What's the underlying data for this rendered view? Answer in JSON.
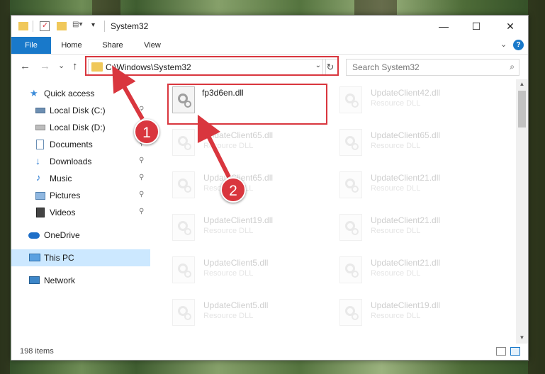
{
  "window": {
    "title": "System32",
    "controls": {
      "minimize": "—",
      "maximize": "☐",
      "close": "✕"
    }
  },
  "ribbon": {
    "tabs": [
      "File",
      "Home",
      "Share",
      "View"
    ],
    "expand_glyph": "⌄",
    "help_glyph": "?"
  },
  "nav": {
    "back_glyph": "←",
    "forward_glyph": "→",
    "recent_glyph": "⌄",
    "up_glyph": "↑",
    "address": "C:\\Windows\\System32",
    "search_placeholder": "Search System32"
  },
  "sidebar": {
    "items": [
      {
        "label": "Quick access",
        "icon": "star-icon"
      },
      {
        "label": "Local Disk (C:)",
        "icon": "drive-icon"
      },
      {
        "label": "Local Disk (D:)",
        "icon": "drive-icon"
      },
      {
        "label": "Documents",
        "icon": "documents-icon"
      },
      {
        "label": "Downloads",
        "icon": "download-icon"
      },
      {
        "label": "Music",
        "icon": "music-icon"
      },
      {
        "label": "Pictures",
        "icon": "pictures-icon"
      },
      {
        "label": "Videos",
        "icon": "videos-icon"
      },
      {
        "label": "OneDrive",
        "icon": "onedrive-icon"
      },
      {
        "label": "This PC",
        "icon": "pc-icon"
      },
      {
        "label": "Network",
        "icon": "network-icon"
      }
    ],
    "pin_glyph": "📌"
  },
  "files": [
    {
      "name": "fp3d6en.dll",
      "type": ""
    },
    {
      "name": "UpdateClient42.dll",
      "type": "Resource DLL"
    },
    {
      "name": "UpdateClient65.dll",
      "type": "Resource DLL"
    },
    {
      "name": "UpdateClient65.dll",
      "type": "Resource DLL"
    },
    {
      "name": "UpdateClient65.dll",
      "type": "Resource DLL"
    },
    {
      "name": "UpdateClient21.dll",
      "type": "Resource DLL"
    },
    {
      "name": "UpdateClient19.dll",
      "type": "Resource DLL"
    },
    {
      "name": "UpdateClient21.dll",
      "type": "Resource DLL"
    },
    {
      "name": "UpdateClient5.dll",
      "type": "Resource DLL"
    },
    {
      "name": "UpdateClient21.dll",
      "type": "Resource DLL"
    },
    {
      "name": "UpdateClient5.dll",
      "type": "Resource DLL"
    },
    {
      "name": "UpdateClient19.dll",
      "type": "Resource DLL"
    }
  ],
  "status": {
    "item_count": "198 items"
  },
  "annotations": {
    "step1": "1",
    "step2": "2",
    "color": "#d9363e"
  }
}
